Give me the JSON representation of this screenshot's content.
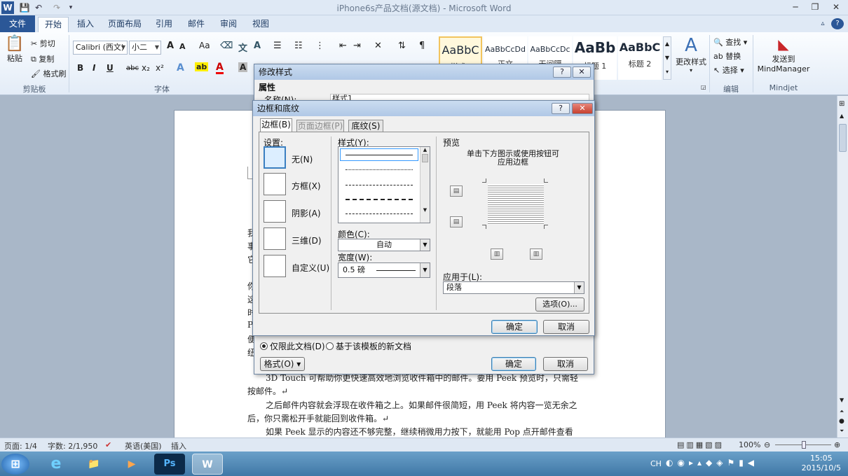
{
  "titlebar": {
    "title": "iPhone6s产品文档(源文档) - Microsoft Word",
    "word_icon": "W",
    "minimize": "─",
    "restore": "❐",
    "close": "✕"
  },
  "tabs": [
    "文件",
    "开始",
    "插入",
    "页面布局",
    "引用",
    "邮件",
    "审阅",
    "视图"
  ],
  "ribbon": {
    "clipboard": {
      "paste": "粘贴",
      "cut": "剪切",
      "copy": "复制",
      "format_painter": "格式刷",
      "label": "剪贴板"
    },
    "font": {
      "font_name": "Calibri (西文)",
      "font_size": "小二",
      "label": "字体",
      "bold": "B",
      "italic": "I",
      "underline": "U",
      "strike": "abc",
      "sub": "x₂",
      "sup": "x²",
      "grow": "A",
      "shrink": "A",
      "case": "Aa"
    },
    "styles": [
      {
        "sample": "AaBbC",
        "name": "样式1"
      },
      {
        "sample": "AaBbCcDd",
        "name": "正文"
      },
      {
        "sample": "AaBbCcDc",
        "name": "无间隔"
      },
      {
        "sample": "AaBb",
        "name": "标题 1"
      },
      {
        "sample": "AaBbC",
        "name": "标题 2"
      }
    ],
    "change_styles": "更改样式",
    "editing": {
      "find": "查找",
      "replace": "替换",
      "select": "选择",
      "label": "编辑"
    },
    "mindjet": {
      "send_line1": "发送到",
      "send_line2": "MindManager",
      "label": "Mindjet"
    }
  },
  "document": {
    "lines": [
      "我",
      "事",
      "它",
      "你",
      "这",
      "时",
      "P",
      "便",
      "纽",
      "3D Touch 可帮助你更快速高效地浏览收件箱中的邮件。要用 Peek 预览时，只需轻",
      "按邮件。↵",
      "之后邮件内容就会浮现在收件箱之上。如果邮件很简短，用 Peek 将内容一览无余之",
      "后，你只需松开手就能回到收件箱。↵",
      "如果 Peek 显示的内容还不够完整，继续稍微用力按下，就能用 Pop 点开邮件查看"
    ]
  },
  "modify_style_dialog": {
    "title": "修改样式",
    "help": "?",
    "close": "✕",
    "section": "属性",
    "name_label": "名称(N):",
    "name_value": "样式1",
    "only_this_doc": "仅限此文档(D)",
    "new_docs": "基于该模板的新文档",
    "format_button": "格式(O) ▾",
    "ok": "确定",
    "cancel": "取消"
  },
  "borders_dialog": {
    "title": "边框和底纹",
    "help": "?",
    "close": "✕",
    "tabs": [
      "边框(B)",
      "页面边框(P)",
      "底纹(S)"
    ],
    "setting_label": "设置:",
    "settings": [
      "无(N)",
      "方框(X)",
      "阴影(A)",
      "三维(D)",
      "自定义(U)"
    ],
    "style_label": "样式(Y):",
    "color_label": "颜色(C):",
    "color_value": "自动",
    "width_label": "宽度(W):",
    "width_value": "0.5 磅",
    "preview_label": "预览",
    "preview_hint_1": "单击下方图示或使用按钮可",
    "preview_hint_2": "应用边框",
    "apply_to_label": "应用于(L):",
    "apply_to_value": "段落",
    "options_button": "选项(O)...",
    "ok": "确定",
    "cancel": "取消"
  },
  "status": {
    "page": "页面: 1/4",
    "words": "字数: 2/1,950",
    "language": "英语(美国)",
    "insert": "插入",
    "zoom": "100%"
  },
  "taskbar": {
    "apps": [
      "e",
      "📁",
      "▶",
      "Ps",
      "W"
    ],
    "tray_lang": "CH",
    "time": "15:05",
    "date": "2015/10/5"
  },
  "colors": {
    "file_tab": "#2b5797",
    "dialog_title": "#b0c8e6",
    "taskbar": "#3f77a6"
  }
}
